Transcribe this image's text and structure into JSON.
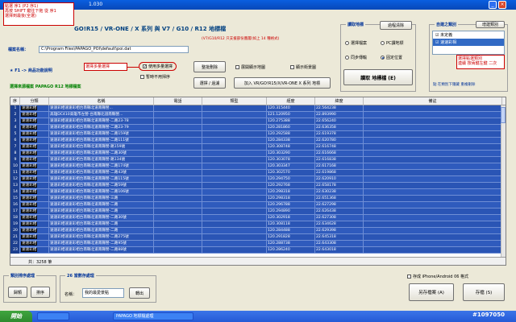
{
  "window": {
    "title": "1.030"
  },
  "header": {
    "title": "GO!R15 / VR-ONE / X 系列 與 V7 / G10 / R12 地標檔",
    "subtitle": "(V7/G10/R12 只支援部份圖層(如上 14 種格式)"
  },
  "top_notes": {
    "note1": "點選 序1 (P2 序1)",
    "note2": "再按 SHIFT 鍵往下拖 從 序1",
    "note3": "選擇到最後(全選)"
  },
  "file": {
    "label": "檔案名稱：",
    "path": "C:\\Program Files\\PAPAGO_POI\\default\\poi.dat"
  },
  "groups": {
    "mode_label": "讀取地標",
    "mode_button": "過程清除",
    "radio_items": [
      "選擇檔案",
      "PC讀地標",
      "同步傳輸",
      "固定位置"
    ],
    "radio_selected": 3,
    "read_button": "讀取 地標檔 (E)",
    "auto_label": "自建之類別",
    "auto_button": "增建類別",
    "categories": [
      "未定義",
      "速速彩相"
    ]
  },
  "mid": {
    "func_link": "F1 -> 商品功能說明",
    "select_note": "選擇多量選擇",
    "use_multi": "使用多量選擇",
    "temp_noscan": "暫時不用掃序",
    "btn_sort": "整批刪除",
    "btn_select": "選擇 / 過濾",
    "chk_show_map": "展開顯示地圖",
    "chk_show_rect": "顯示街景圖",
    "btn_convert": "加入 VR/GO!R15/X/VR-ONE X 系列 地標",
    "source_label": "選擇來源檔案 PAPAGO R12 地標檔案",
    "right_note1": "選擇點選類別",
    "right_note2": "連續 按兩鍵左鍵 二次",
    "category_hint": "點 在類別下隱藏 重複刪除"
  },
  "table": {
    "columns": [
      "序",
      "分類",
      "名稱",
      "電話",
      "類型",
      "經度",
      "緯度",
      "備註"
    ],
    "rows": [
      [
        "1",
        "速速彩相",
        "速速彩相速速彩相台南縣北道南縣營...",
        "",
        "",
        "120.315440",
        "22.564238",
        ""
      ],
      [
        "2",
        "速速彩相",
        "高雄DC410高雄市左營-台南縣北道南縣營...",
        "",
        "",
        "121.120950",
        "22.893990",
        ""
      ],
      [
        "3",
        "速速彩相",
        "速速彩相速速彩相台南縣北道南縣營-二路23-78",
        "",
        "",
        "120.275388",
        "22.656240",
        ""
      ],
      [
        "4",
        "速速彩相",
        "速速彩相速速彩相台南縣北道南縣營-二路23-79",
        "",
        "",
        "120.281860",
        "22.636358",
        ""
      ],
      [
        "5",
        "速速彩相",
        "速速彩相速速彩相台南縣北道南縣營-二路159號",
        "",
        "",
        "120.292588",
        "22.619378",
        ""
      ],
      [
        "6",
        "速速彩相",
        "速速彩相速速彩相台南縣北道南縣營-二路111號",
        "",
        "",
        "120.284338",
        "22.620780",
        ""
      ],
      [
        "7",
        "速速彩相",
        "速速彩相速速彩相台南縣北道南縣營-路159號",
        "",
        "",
        "120.308748",
        "22.616748",
        ""
      ],
      [
        "8",
        "速速彩相",
        "速速彩相速速彩相台南縣北道南縣營-二路30號",
        "",
        "",
        "120.303290",
        "22.616668",
        ""
      ],
      [
        "9",
        "速速彩相",
        "速速彩相速速彩相台南縣北道南縣營-路134號",
        "",
        "",
        "120.303078",
        "22.616838",
        ""
      ],
      [
        "10",
        "速速彩相",
        "速速彩相速速彩相台南縣北道南縣營-二路174號",
        "",
        "",
        "120.303347",
        "22.617168",
        ""
      ],
      [
        "11",
        "速速彩相",
        "速速彩相速速彩相台南縣北道南縣營-二路43號",
        "",
        "",
        "120.302570",
        "22.619868",
        ""
      ],
      [
        "12",
        "速速彩相",
        "速速彩相速速彩相台南縣北道南縣營-二路115號",
        "",
        "",
        "120.294750",
        "22.620910",
        ""
      ],
      [
        "13",
        "速速彩相",
        "速速彩相速速彩相台南縣北道南縣營-二路59號",
        "",
        "",
        "120.292768",
        "22.658178",
        ""
      ],
      [
        "14",
        "速速彩相",
        "速速彩相速速彩相台南縣北道南縣營-二路106號",
        "",
        "",
        "120.298318",
        "22.630238",
        ""
      ],
      [
        "15",
        "速速彩相",
        "速速彩相速速彩相台南縣北道南縣營-三路",
        "",
        "",
        "120.298318",
        "22.651368",
        ""
      ],
      [
        "16",
        "速速彩相",
        "速速彩相速速彩相台南縣北道南縣營-二路",
        "",
        "",
        "120.296788",
        "22.627298",
        ""
      ],
      [
        "17",
        "速速彩相",
        "速速彩相速速彩相台南縣北道南縣營-二路",
        "",
        "",
        "120.294890",
        "22.626438",
        ""
      ],
      [
        "18",
        "速速彩相",
        "速速彩相速速彩相台南縣北道南縣營-二路30號",
        "",
        "",
        "120.302918",
        "22.627308",
        ""
      ],
      [
        "19",
        "速速彩相",
        "速速彩相速速彩相台南縣北道南縣營-二路",
        "",
        "",
        "120.308118",
        "22.634628",
        ""
      ],
      [
        "20",
        "速速彩相",
        "速速彩相速速彩相台南縣北道南縣營-二路",
        "",
        "",
        "120.284488",
        "22.629398",
        ""
      ],
      [
        "21",
        "速速彩相",
        "速速彩相速速彩相台南縣北道南縣營-二路275號",
        "",
        "",
        "120.291828",
        "22.645318",
        ""
      ],
      [
        "22",
        "速速彩相",
        "速速彩相速速彩相台南縣北道南縣營-二路95號",
        "",
        "",
        "120.288738",
        "22.643308",
        ""
      ],
      [
        "23",
        "速速彩相",
        "速速彩相速速彩相台南縣北道南縣營-二路88號",
        "",
        "",
        "120.286240",
        "22.643018",
        ""
      ]
    ],
    "footer": "共：3258 筆"
  },
  "bottom": {
    "group1_label": "類別排序處理",
    "btn_sort_a": "歸類",
    "btn_sort_b": "排序",
    "group2_label": "26 當數存處理",
    "name_label": "名稱：",
    "name_value": "我的最愛景點",
    "btn_rename": "轉出",
    "export_chk": "存成 iPhone/Android 06 格式",
    "btn_save_as": "另存檔案 (A)",
    "btn_save": "存檔 (S)"
  },
  "taskbar": {
    "start": "開始",
    "task1": "",
    "task2": "PAPAGO 地標檔處理",
    "watermark": "#1097050"
  }
}
